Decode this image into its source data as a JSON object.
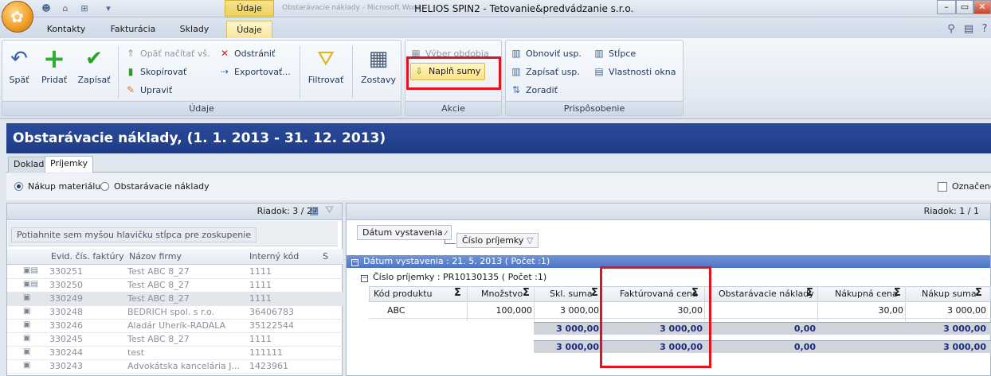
{
  "titlebar": {
    "context_tab": "Údaje",
    "ghost_text": "Obstarávacie náklady - Microsoft Word",
    "window_title": "HELIOS SPIN2 - Tetovanie&predvádzanie s.r.o.",
    "min": "–",
    "restore": "▭",
    "close": "✕"
  },
  "tabs": [
    "Kontakty",
    "Fakturácia",
    "Sklady",
    "Údaje"
  ],
  "ribbon": {
    "groups": {
      "udaje": "Údaje",
      "akcie": "Akcie",
      "prisposobenie": "Prispôsobenie"
    },
    "big_buttons": {
      "spat": "Späť",
      "pridat": "Pridať",
      "zapisat": "Zapísať",
      "filtrovat": "Filtrovať",
      "zostavy": "Zostavy"
    },
    "small_buttons": {
      "opat": "Opäť načítať vš.",
      "skopirovat": "Skopírovať",
      "upravit": "Upraviť",
      "odstranit": "Odstrániť",
      "exportovat": "Exportovať...",
      "vyber_obdobia": "Výber obdobia",
      "napln_sumy": "Naplň sumy",
      "obnovit": "Obnoviť usp.",
      "zapisat_usp": "Zapísať usp.",
      "zoradit": "Zoradiť",
      "stlpce": "Stĺpce",
      "vlastnosti": "Vlastnosti okna"
    }
  },
  "banner": "Obstarávacie náklady,  (1. 1. 2013 - 31. 12. 2013)",
  "subtabs": [
    "Doklad",
    "Príjemky"
  ],
  "filter": {
    "radio1": "Nákup materiálu",
    "radio2": "Obstarávacie náklady",
    "checkbox": "Označené"
  },
  "left": {
    "row_info": "Riadok: 3 / 27",
    "group_hint": "Potiahnite sem myšou hlavičku stĺpca pre zoskupenie",
    "headers": [
      "Evid. čís. faktúry",
      "Názov firmy",
      "Interný kód",
      "S"
    ],
    "rows": [
      [
        "330251",
        "Test ABC 8_27",
        "1111"
      ],
      [
        "330250",
        "Test ABC 8_27",
        "1111"
      ],
      [
        "330249",
        "Test ABC 8_27",
        "1111"
      ],
      [
        "330248",
        "BEDRICH spol. s r.o.",
        "36406783"
      ],
      [
        "330246",
        "Aladár Uherík-RADALA",
        "35122544"
      ],
      [
        "330245",
        "Test ABC 8_27",
        "1111"
      ],
      [
        "330244",
        "test",
        "111111"
      ],
      [
        "330243",
        "Advokátska kancelária J...",
        "1423961"
      ]
    ]
  },
  "right": {
    "row_info": "Riadok: 1 / 1",
    "chip1": "Dátum vystavenia",
    "chip2": "Číslo príjemky",
    "group1": "Dátum vystavenia : 21. 5. 2013 ( Počet :1)",
    "group2": "Číslo príjemky : PR10130135 ( Počet :1)",
    "headers": [
      "Kód produktu",
      "Množstvo",
      "Skl. suma",
      "Faktúrovaná cena",
      "Obstarávacie náklady",
      "Nákupná cena",
      "Nákup suma"
    ],
    "row": [
      "ABC",
      "100,000",
      "3 000,00",
      "30,00",
      "",
      "30,00",
      "3 000,00"
    ],
    "totals1": [
      "3 000,00",
      "3 000,00",
      "0,00",
      "",
      "3 000,00"
    ],
    "totals2": [
      "3 000,00",
      "3 000,00",
      "0,00",
      "",
      "3 000,00"
    ]
  }
}
